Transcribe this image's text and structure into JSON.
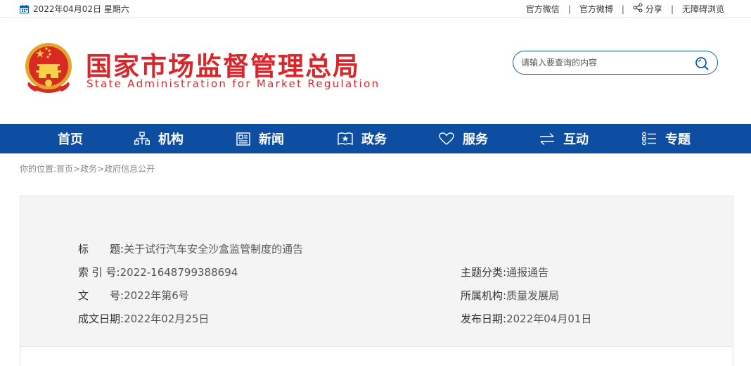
{
  "topbar": {
    "date": "2022年04月02日 星期六",
    "links": {
      "wechat": "官方微信",
      "weibo": "官方微博",
      "share": "分享",
      "accessible": "无障碍浏览"
    },
    "separator": "|"
  },
  "header": {
    "title_cn": "国家市场监督管理总局",
    "title_en": "State Administration for Market Regulation",
    "search_placeholder": "请输入要查询的内容"
  },
  "nav": {
    "items": [
      {
        "label": "首页",
        "icon": "none"
      },
      {
        "label": "机构",
        "icon": "org-chart-icon"
      },
      {
        "label": "新闻",
        "icon": "newspaper-icon"
      },
      {
        "label": "政务",
        "icon": "star-book-icon"
      },
      {
        "label": "服务",
        "icon": "heart-icon"
      },
      {
        "label": "互动",
        "icon": "swap-arrows-icon"
      },
      {
        "label": "专题",
        "icon": "topic-list-icon"
      }
    ]
  },
  "breadcrumb": "你的位置:首页>政务>政府信息公开",
  "document": {
    "title_label": "标　　题:",
    "title_value": "关于试行汽车安全沙盒监管制度的通告",
    "index_label": "索 引 号:",
    "index_value": "2022-1648799388694",
    "topic_label": "主题分类:",
    "topic_value": "通报通告",
    "docno_label": "文　　号:",
    "docno_value": "2022年第6号",
    "org_label": "所属机构:",
    "org_value": "质量发展局",
    "created_label": "成文日期:",
    "created_value": "2022年02月25日",
    "published_label": "发布日期:",
    "published_value": "2022年04月01日"
  },
  "colors": {
    "brand_red": "#d7272b",
    "nav_blue": "#0d4ea3",
    "panel_bg": "#f4f4f4"
  }
}
